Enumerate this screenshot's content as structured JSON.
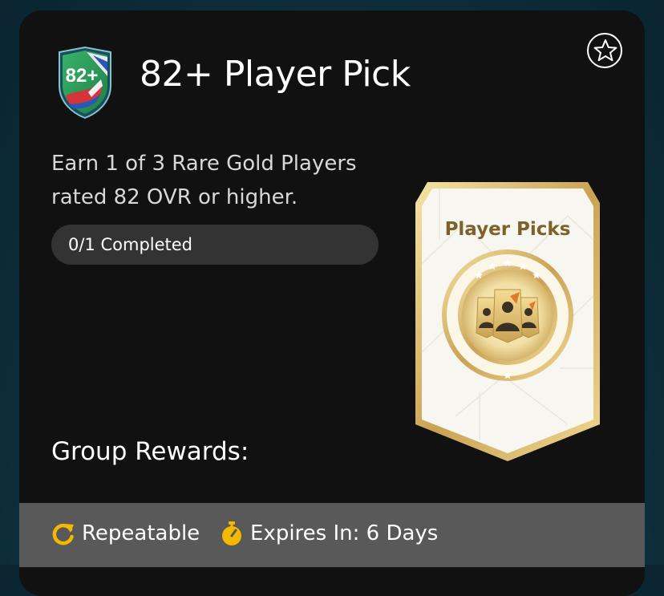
{
  "objective": {
    "badge_text": "82+",
    "title": "82+ Player Pick",
    "description_line1": "Earn 1 of 3 Rare Gold Players",
    "description_line2": "rated 82 OVR or higher.",
    "progress_label": "0/1 Completed",
    "progress_value": 0,
    "group_rewards_title": "Group Rewards:"
  },
  "reward": {
    "pack_title": "Player Picks"
  },
  "footer": {
    "repeatable_label": "Repeatable",
    "expires_label": "Expires In: 6 Days"
  },
  "icons": {
    "favorite": "star-outline-icon",
    "repeat": "repeat-arrow-icon",
    "timer": "stopwatch-icon"
  },
  "colors": {
    "card_bg": "#111111",
    "footer_bg": "#595959",
    "accent_gold": "#f5b800",
    "progress_bg": "#333333",
    "pack_text": "#7c6128"
  }
}
